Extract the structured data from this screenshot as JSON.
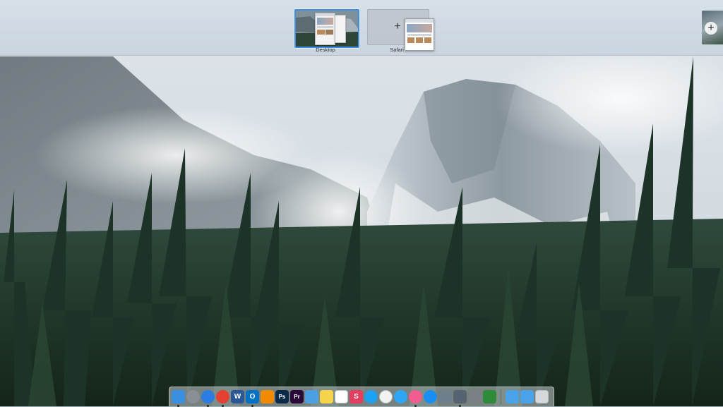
{
  "mission_control": {
    "spaces": [
      {
        "label": "Desktop",
        "active": true
      },
      {
        "label": "Safari",
        "active": false
      }
    ],
    "add_space_symbol": "+"
  },
  "dock": {
    "apps": [
      {
        "name": "finder-icon",
        "color": "#3b8fe0"
      },
      {
        "name": "launchpad-icon",
        "color": "#8a8f96"
      },
      {
        "name": "safari-icon",
        "color": "#2a7de1"
      },
      {
        "name": "chrome-icon",
        "color": "#e44134"
      },
      {
        "name": "word-icon",
        "color": "#2b5797",
        "glyph": "W"
      },
      {
        "name": "outlook-icon",
        "color": "#0072c6",
        "glyph": "O"
      },
      {
        "name": "vlc-icon",
        "color": "#f08a00"
      },
      {
        "name": "photoshop-icon",
        "color": "#0b2a4a",
        "glyph": "Ps"
      },
      {
        "name": "premiere-icon",
        "color": "#2a0a3a",
        "glyph": "Pr"
      },
      {
        "name": "pen-icon",
        "color": "#4aa0e0"
      },
      {
        "name": "notes-icon",
        "color": "#f5d34b"
      },
      {
        "name": "calendar-icon",
        "color": "#ffffff"
      },
      {
        "name": "slack-icon",
        "color": "#e33d5f",
        "glyph": "S"
      },
      {
        "name": "twitter-icon",
        "color": "#1da1f2"
      },
      {
        "name": "photos-icon",
        "color": "#f2f2f2"
      },
      {
        "name": "messages-icon",
        "color": "#2fa6f5"
      },
      {
        "name": "itunes-icon",
        "color": "#f25c8f"
      },
      {
        "name": "app-store-icon",
        "color": "#1b8ef2"
      },
      {
        "name": "preview-icon",
        "color": "#6e7f8c"
      },
      {
        "name": "screenshot-icon",
        "color": "#566370"
      },
      {
        "name": "system-preferences-icon",
        "color": "#7a7f85"
      },
      {
        "name": "camtasia-icon",
        "color": "#2e8b3a"
      }
    ],
    "folders": [
      {
        "name": "applications-folder-icon",
        "color": "#4aa3e8"
      },
      {
        "name": "downloads-folder-icon",
        "color": "#4aa3e8"
      },
      {
        "name": "trash-icon",
        "color": "#d6d9dc"
      }
    ]
  }
}
